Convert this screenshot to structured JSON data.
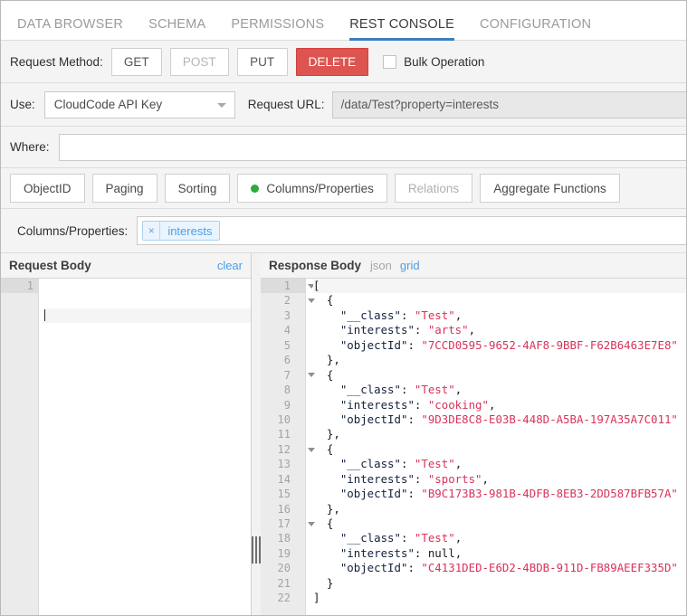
{
  "tabs": [
    {
      "label": "DATA BROWSER",
      "active": false
    },
    {
      "label": "SCHEMA",
      "active": false
    },
    {
      "label": "PERMISSIONS",
      "active": false
    },
    {
      "label": "REST CONSOLE",
      "active": true
    },
    {
      "label": "CONFIGURATION",
      "active": false
    }
  ],
  "request_method": {
    "label": "Request Method:",
    "buttons": [
      {
        "label": "GET",
        "state": "normal"
      },
      {
        "label": "POST",
        "state": "dim"
      },
      {
        "label": "PUT",
        "state": "normal"
      },
      {
        "label": "DELETE",
        "state": "active"
      }
    ],
    "bulk_label": "Bulk Operation",
    "bulk_checked": false
  },
  "use_row": {
    "label": "Use:",
    "select_value": "CloudCode API Key",
    "url_label": "Request URL:",
    "url_value": "/data/Test?property=interests"
  },
  "where_row": {
    "label": "Where:",
    "value": ""
  },
  "subtabs": [
    {
      "label": "ObjectID",
      "dot": false,
      "dim": false
    },
    {
      "label": "Paging",
      "dot": false,
      "dim": false
    },
    {
      "label": "Sorting",
      "dot": false,
      "dim": false
    },
    {
      "label": "Columns/Properties",
      "dot": true,
      "dim": false
    },
    {
      "label": "Relations",
      "dot": false,
      "dim": true
    },
    {
      "label": "Aggregate Functions",
      "dot": false,
      "dim": false
    }
  ],
  "columns_row": {
    "label": "Columns/Properties:",
    "chips": [
      {
        "label": "interests",
        "remove": "×"
      }
    ]
  },
  "request_body": {
    "title": "Request Body",
    "clear_label": "clear",
    "lines": [
      ""
    ],
    "active_line": 1
  },
  "response_body": {
    "title": "Response Body",
    "view_json_label": "json",
    "view_grid_label": "grid",
    "active_view": "json",
    "total_lines": 22,
    "fold_lines": [
      1,
      2,
      7,
      12,
      17
    ],
    "active_line": 1,
    "json": [
      {
        "__class": "Test",
        "interests": "arts",
        "objectId": "7CCD0595-9652-4AF8-9BBF-F62B6463E7E8"
      },
      {
        "__class": "Test",
        "interests": "cooking",
        "objectId": "9D3DE8C8-E03B-448D-A5BA-197A35A7C011"
      },
      {
        "__class": "Test",
        "interests": "sports",
        "objectId": "B9C173B3-981B-4DFB-8EB3-2DD587BFB57A"
      },
      {
        "__class": "Test",
        "interests": null,
        "objectId": "C4131DED-E6D2-4BDB-911D-FB89AEEF335D"
      }
    ]
  },
  "colors": {
    "accent_blue": "#3a7fc1",
    "delete_red": "#dd5450",
    "status_green": "#2eaa3c",
    "link_blue": "#4a9fe8",
    "json_string": "#d8335a",
    "json_key": "#14213d"
  }
}
